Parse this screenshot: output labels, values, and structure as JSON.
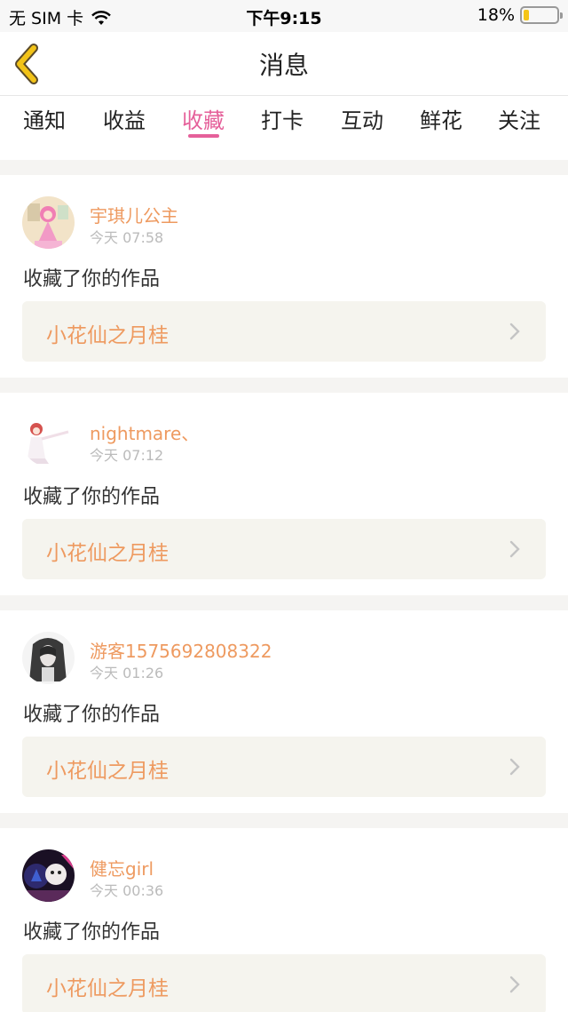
{
  "status": {
    "carrier": "无 SIM 卡",
    "time": "下午9:15",
    "battery": "18%",
    "battery_level": 0.18
  },
  "nav": {
    "title": "消息"
  },
  "tabs": [
    {
      "label": "通知",
      "active": false
    },
    {
      "label": "收益",
      "active": false
    },
    {
      "label": "收藏",
      "active": true
    },
    {
      "label": "打卡",
      "active": false
    },
    {
      "label": "互动",
      "active": false
    },
    {
      "label": "鲜花",
      "active": false
    },
    {
      "label": "关注",
      "active": false
    }
  ],
  "messages": [
    {
      "username": "宇琪儿公主",
      "time": "今天 07:58",
      "action": "收藏了你的作品",
      "work": "小花仙之月桂"
    },
    {
      "username": "nightmare、",
      "time": "今天 07:12",
      "action": "收藏了你的作品",
      "work": "小花仙之月桂"
    },
    {
      "username": "游客1575692808322",
      "time": "今天 01:26",
      "action": "收藏了你的作品",
      "work": "小花仙之月桂"
    },
    {
      "username": "健忘girl",
      "time": "今天 00:36",
      "action": "收藏了你的作品",
      "work": "小花仙之月桂"
    }
  ],
  "colors": {
    "accent_pink": "#e5609a",
    "name_orange": "#ee9a60",
    "back_yellow": "#f2c318"
  }
}
